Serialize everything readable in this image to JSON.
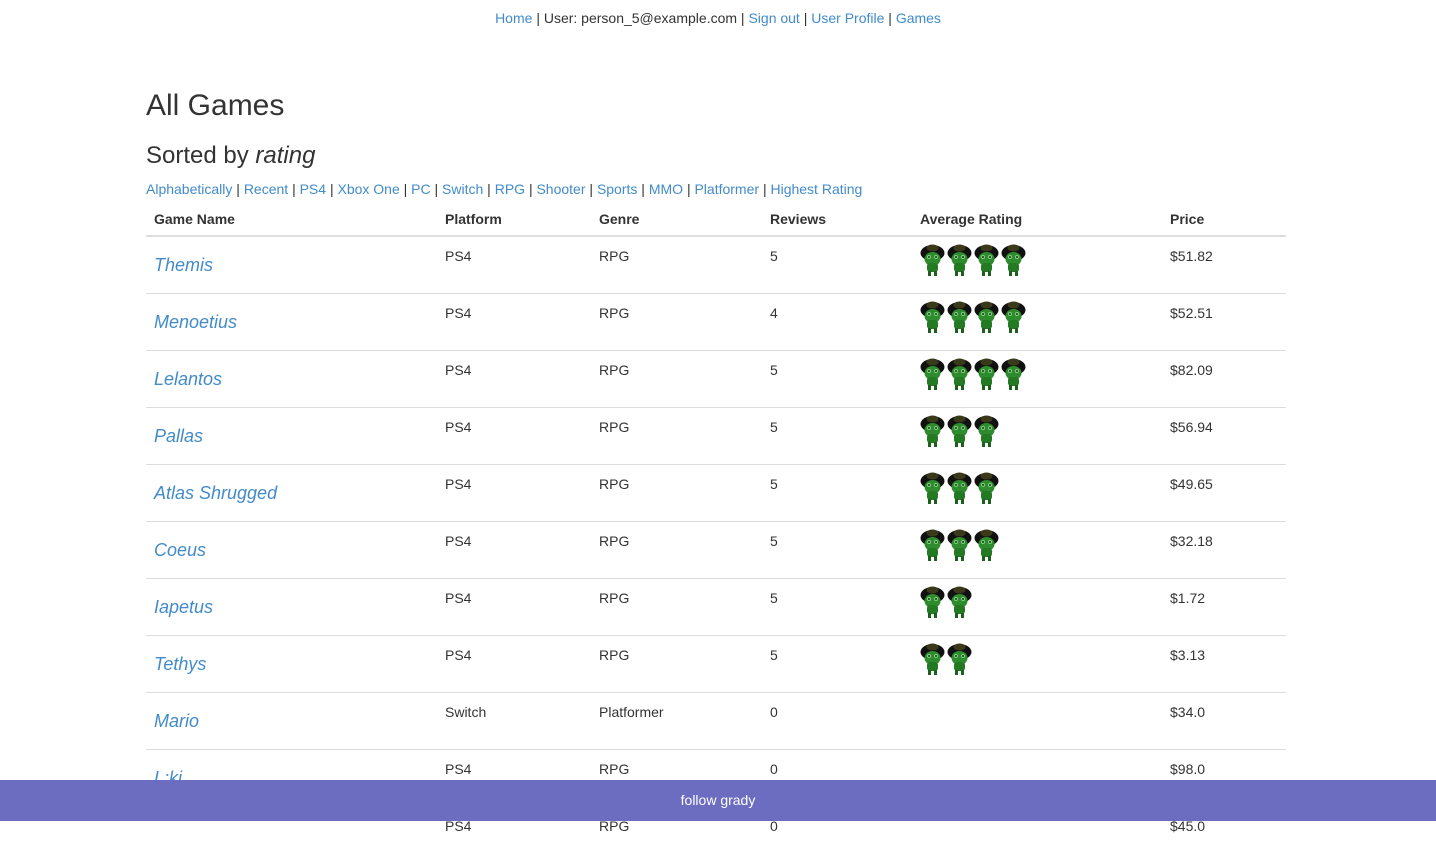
{
  "nav": {
    "home": "Home",
    "user_text": "User: person_5@example.com",
    "sign_out": "Sign out",
    "user_profile": "User Profile",
    "games": "Games",
    "separator": "|"
  },
  "page_title": "All Games",
  "sorted": {
    "prefix": "Sorted by ",
    "key": "rating"
  },
  "filters": [
    "Alphabetically",
    "Recent",
    "PS4",
    "Xbox One",
    "PC",
    "Switch",
    "RPG",
    "Shooter",
    "Sports",
    "MMO",
    "Platformer",
    "Highest Rating"
  ],
  "table": {
    "headers": [
      "Game Name",
      "Platform",
      "Genre",
      "Reviews",
      "Average Rating",
      "Price"
    ],
    "rating_icon": "green-troll-rating-icon",
    "rows": [
      {
        "name": "Themis",
        "platform": "PS4",
        "genre": "RPG",
        "reviews": "5",
        "rating": 4,
        "price": "$51.82"
      },
      {
        "name": "Menoetius",
        "platform": "PS4",
        "genre": "RPG",
        "reviews": "4",
        "rating": 4,
        "price": "$52.51"
      },
      {
        "name": "Lelantos",
        "platform": "PS4",
        "genre": "RPG",
        "reviews": "5",
        "rating": 4,
        "price": "$82.09"
      },
      {
        "name": "Pallas",
        "platform": "PS4",
        "genre": "RPG",
        "reviews": "5",
        "rating": 3,
        "price": "$56.94"
      },
      {
        "name": "Atlas Shrugged",
        "platform": "PS4",
        "genre": "RPG",
        "reviews": "5",
        "rating": 3,
        "price": "$49.65"
      },
      {
        "name": "Coeus",
        "platform": "PS4",
        "genre": "RPG",
        "reviews": "5",
        "rating": 3,
        "price": "$32.18"
      },
      {
        "name": "Iapetus",
        "platform": "PS4",
        "genre": "RPG",
        "reviews": "5",
        "rating": 2,
        "price": "$1.72"
      },
      {
        "name": "Tethys",
        "platform": "PS4",
        "genre": "RPG",
        "reviews": "5",
        "rating": 2,
        "price": "$3.13"
      },
      {
        "name": "Mario",
        "platform": "Switch",
        "genre": "Platformer",
        "reviews": "0",
        "rating": 0,
        "price": "$34.0"
      },
      {
        "name": "L;kj",
        "platform": "PS4",
        "genre": "RPG",
        "reviews": "0",
        "rating": 0,
        "price": "$98.0"
      },
      {
        "name": "",
        "platform": "PS4",
        "genre": "RPG",
        "reviews": "0",
        "rating": 0,
        "price": "$45.0"
      }
    ]
  },
  "footer": {
    "text": "follow grady",
    "background": "#6c6cc1"
  },
  "colors": {
    "link": "#428bca",
    "text": "#333333",
    "rating_green": "#2e8b2e"
  }
}
